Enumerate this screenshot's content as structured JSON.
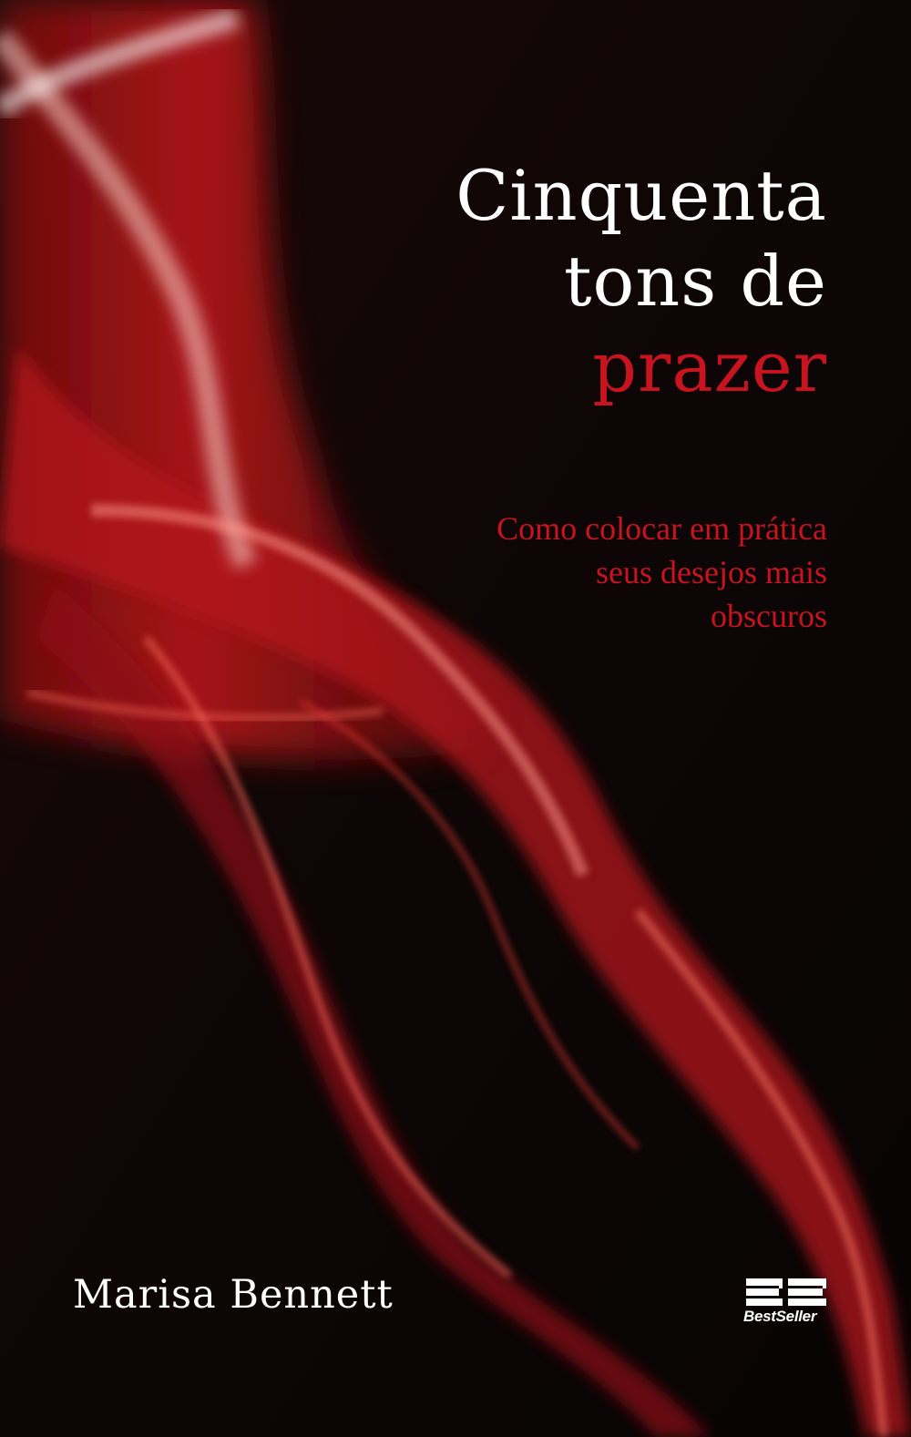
{
  "cover": {
    "title_lines": [
      "Cinquenta",
      "tons de",
      "prazer"
    ],
    "subtitle_lines": [
      "Como colocar em prática",
      "seus desejos mais",
      "obscuros"
    ],
    "author": "Marisa Bennett",
    "publisher_logo_text": "BestSeller",
    "colors": {
      "background": "#0d0707",
      "accent_red": "#c8141f",
      "title_white": "#ffffff"
    }
  }
}
